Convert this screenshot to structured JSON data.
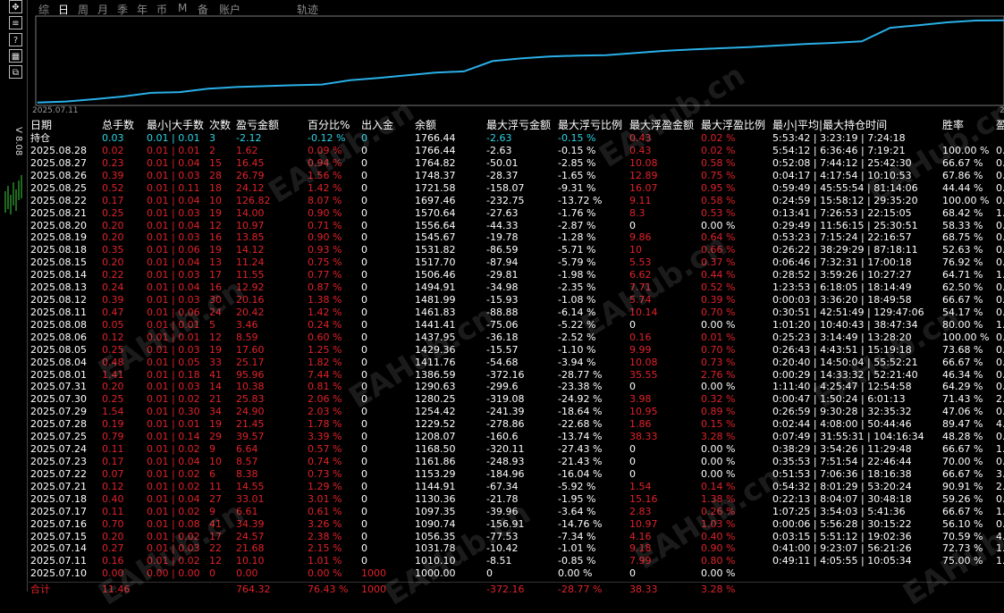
{
  "tabs": [
    "综",
    "日",
    "周",
    "月",
    "季",
    "年",
    "币",
    "M",
    "备",
    "账户",
    "轨迹"
  ],
  "active_tab": 1,
  "left_panel": {
    "version": "V 8.08"
  },
  "chart": {
    "date_start": "2025.07.11",
    "date_end": "2"
  },
  "chart_data": {
    "type": "line",
    "x": [
      "2025.07.10",
      "2025.07.11",
      "2025.07.14",
      "2025.07.15",
      "2025.07.16",
      "2025.07.17",
      "2025.07.18",
      "2025.07.21",
      "2025.07.22",
      "2025.07.23",
      "2025.07.24",
      "2025.07.25",
      "2025.07.28",
      "2025.07.29",
      "2025.07.30",
      "2025.07.31",
      "2025.08.01",
      "2025.08.04",
      "2025.08.05",
      "2025.08.06",
      "2025.08.08",
      "2025.08.11",
      "2025.08.12",
      "2025.08.13",
      "2025.08.14",
      "2025.08.15",
      "2025.08.18",
      "2025.08.19",
      "2025.08.20",
      "2025.08.21",
      "2025.08.22",
      "2025.08.25",
      "2025.08.26",
      "2025.08.27",
      "2025.08.28"
    ],
    "y": [
      1000.0,
      1010.1,
      1031.78,
      1056.35,
      1090.74,
      1097.35,
      1130.36,
      1144.91,
      1153.29,
      1161.86,
      1168.5,
      1208.07,
      1229.52,
      1254.42,
      1280.25,
      1290.63,
      1386.59,
      1411.76,
      1429.36,
      1437.95,
      1441.41,
      1461.83,
      1481.99,
      1494.91,
      1506.46,
      1517.7,
      1531.82,
      1545.67,
      1556.64,
      1570.64,
      1697.46,
      1721.58,
      1748.37,
      1764.82,
      1766.44
    ],
    "ylim": [
      990,
      1790
    ]
  },
  "table": {
    "headers": [
      "日期",
      "总手数",
      "最小|大手数",
      "次数",
      "盈亏金额",
      "百分比%",
      "出入金",
      "余额",
      "最大浮亏金额",
      "最大浮亏比例",
      "最大浮盈金额",
      "最大浮盈比例",
      "最小|平均|最大持仓时间",
      "胜率",
      "盈"
    ],
    "holding": [
      "持仓",
      "0.03",
      "0.01 | 0.01",
      "3",
      "-2.12",
      "-0.12 %",
      "0",
      "1766.44",
      "-2.63",
      "-0.15 %",
      "0.43",
      "0.02 %",
      "5:53:42 | 3:23:19 | 7:24:18",
      "",
      ""
    ],
    "rows": [
      [
        "2025.08.28",
        "0.02",
        "0.01 | 0.01",
        "2",
        "1.62",
        "0.09 %",
        "0",
        "1766.44",
        "-2.63",
        "-0.15 %",
        "0.43",
        "0.02 %",
        "5:54:12 | 6:36:46 | 7:19:21",
        "100.00 %",
        "0."
      ],
      [
        "2025.08.27",
        "0.23",
        "0.01 | 0.04",
        "15",
        "16.45",
        "0.94 %",
        "0",
        "1764.82",
        "-50.01",
        "-2.85 %",
        "10.08",
        "0.58 %",
        "0:52:08 | 7:44:12 | 25:42:30",
        "66.67 %",
        "0."
      ],
      [
        "2025.08.26",
        "0.39",
        "0.01 | 0.03",
        "28",
        "26.79",
        "1.56 %",
        "0",
        "1748.37",
        "-28.37",
        "-1.65 %",
        "12.89",
        "0.75 %",
        "0:04:17 | 4:17:54 | 10:10:53",
        "67.86 %",
        "0."
      ],
      [
        "2025.08.25",
        "0.52",
        "0.01 | 0.11",
        "18",
        "24.12",
        "1.42 %",
        "0",
        "1721.58",
        "-158.07",
        "-9.31 %",
        "16.07",
        "0.95 %",
        "0:59:49 | 45:55:54 | 81:14:06",
        "44.44 %",
        "0."
      ],
      [
        "2025.08.22",
        "0.17",
        "0.01 | 0.04",
        "10",
        "126.82",
        "8.07 %",
        "0",
        "1697.46",
        "-232.75",
        "-13.72 %",
        "9.11",
        "0.58 %",
        "0:24:59 | 15:58:12 | 29:35:20",
        "100.00 %",
        "0."
      ],
      [
        "2025.08.21",
        "0.25",
        "0.01 | 0.03",
        "19",
        "14.00",
        "0.90 %",
        "0",
        "1570.64",
        "-27.63",
        "-1.76 %",
        "8.3",
        "0.53 %",
        "0:13:41 | 7:26:53 | 22:15:05",
        "68.42 %",
        "1."
      ],
      [
        "2025.08.20",
        "0.20",
        "0.01 | 0.04",
        "12",
        "10.97",
        "0.71 %",
        "0",
        "1556.64",
        "-44.33",
        "-2.87 %",
        "0",
        "0.00 %",
        "0:29:49 | 11:56:15 | 25:30:51",
        "58.33 %",
        "0."
      ],
      [
        "2025.08.19",
        "0.20",
        "0.01 | 0.03",
        "16",
        "13.85",
        "0.90 %",
        "0",
        "1545.67",
        "-19.78",
        "-1.28 %",
        "9.86",
        "0.64 %",
        "0:53:23 | 7:15:24 | 22:16:57",
        "68.75 %",
        "0."
      ],
      [
        "2025.08.18",
        "0.35",
        "0.01 | 0.06",
        "19",
        "14.12",
        "0.93 %",
        "0",
        "1531.82",
        "-86.59",
        "-5.71 %",
        "10",
        "0.66 %",
        "0:26:22 | 38:29:29 | 87:18:11",
        "52.63 %",
        "0."
      ],
      [
        "2025.08.15",
        "0.20",
        "0.01 | 0.04",
        "13",
        "11.24",
        "0.75 %",
        "0",
        "1517.70",
        "-87.94",
        "-5.79 %",
        "5.53",
        "0.37 %",
        "0:06:46 | 7:32:31 | 17:00:18",
        "76.92 %",
        "0."
      ],
      [
        "2025.08.14",
        "0.22",
        "0.01 | 0.03",
        "17",
        "11.55",
        "0.77 %",
        "0",
        "1506.46",
        "-29.81",
        "-1.98 %",
        "6.62",
        "0.44 %",
        "0:28:52 | 3:59:26 | 10:27:27",
        "64.71 %",
        "1."
      ],
      [
        "2025.08.13",
        "0.24",
        "0.01 | 0.04",
        "16",
        "12.92",
        "0.87 %",
        "0",
        "1494.91",
        "-34.98",
        "-2.35 %",
        "7.71",
        "0.52 %",
        "1:23:53 | 6:18:05 | 18:14:49",
        "62.50 %",
        "0."
      ],
      [
        "2025.08.12",
        "0.39",
        "0.01 | 0.03",
        "30",
        "20.16",
        "1.38 %",
        "0",
        "1481.99",
        "-15.93",
        "-1.08 %",
        "5.74",
        "0.39 %",
        "0:00:03 | 3:36:20 | 18:49:58",
        "66.67 %",
        "0."
      ],
      [
        "2025.08.11",
        "0.47",
        "0.01 | 0.06",
        "24",
        "20.42",
        "1.42 %",
        "0",
        "1461.83",
        "-88.88",
        "-6.14 %",
        "10.14",
        "0.70 %",
        "0:30:51 | 42:51:49 | 129:47:06",
        "54.17 %",
        "0."
      ],
      [
        "2025.08.08",
        "0.05",
        "0.01 | 0.01",
        "5",
        "3.46",
        "0.24 %",
        "0",
        "1441.41",
        "-75.06",
        "-5.22 %",
        "0",
        "0.00 %",
        "1:01:20 | 10:40:43 | 38:47:34",
        "80.00 %",
        "1."
      ],
      [
        "2025.08.06",
        "0.12",
        "0.01 | 0.01",
        "12",
        "8.59",
        "0.60 %",
        "0",
        "1437.95",
        "-36.18",
        "-2.52 %",
        "0.16",
        "0.01 %",
        "0:25:23 | 3:14:49 | 13:28:20",
        "100.00 %",
        "0."
      ],
      [
        "2025.08.05",
        "0.25",
        "0.01 | 0.03",
        "19",
        "17.60",
        "1.25 %",
        "0",
        "1429.36",
        "-15.57",
        "-1.10 %",
        "9.99",
        "0.70 %",
        "0:26:43 | 4:43:51 | 15:19:18",
        "73.68 %",
        "0."
      ],
      [
        "2025.08.04",
        "0.48",
        "0.01 | 0.05",
        "33",
        "25.17",
        "1.82 %",
        "0",
        "1411.76",
        "-54.68",
        "-3.94 %",
        "10.08",
        "0.73 %",
        "0:20:40 | 14:50:04 | 55:52:21",
        "66.67 %",
        "0."
      ],
      [
        "2025.08.01",
        "1.41",
        "0.01 | 0.18",
        "41",
        "95.96",
        "7.44 %",
        "0",
        "1386.59",
        "-372.16",
        "-28.77 %",
        "35.55",
        "2.76 %",
        "0:00:29 | 14:33:32 | 52:21:40",
        "46.34 %",
        "0."
      ],
      [
        "2025.07.31",
        "0.20",
        "0.01 | 0.03",
        "14",
        "10.38",
        "0.81 %",
        "0",
        "1290.63",
        "-299.6",
        "-23.38 %",
        "0",
        "0.00 %",
        "1:11:40 | 4:25:47 | 12:54:58",
        "64.29 %",
        "0."
      ],
      [
        "2025.07.30",
        "0.25",
        "0.01 | 0.02",
        "21",
        "25.83",
        "2.06 %",
        "0",
        "1280.25",
        "-319.08",
        "-24.92 %",
        "3.98",
        "0.32 %",
        "0:00:47 | 1:50:24 | 6:01:13",
        "71.43 %",
        "2."
      ],
      [
        "2025.07.29",
        "1.54",
        "0.01 | 0.30",
        "34",
        "24.90",
        "2.03 %",
        "0",
        "1254.42",
        "-241.39",
        "-18.64 %",
        "10.95",
        "0.89 %",
        "0:26:59 | 9:30:28 | 32:35:32",
        "47.06 %",
        "0."
      ],
      [
        "2025.07.28",
        "0.19",
        "0.01 | 0.01",
        "19",
        "21.45",
        "1.78 %",
        "0",
        "1229.52",
        "-278.86",
        "-22.68 %",
        "1.86",
        "0.15 %",
        "0:02:44 | 4:08:00 | 50:44:46",
        "89.47 %",
        "4."
      ],
      [
        "2025.07.25",
        "0.79",
        "0.01 | 0.14",
        "29",
        "39.57",
        "3.39 %",
        "0",
        "1208.07",
        "-160.6",
        "-13.74 %",
        "38.33",
        "3.28 %",
        "0:07:49 | 31:55:31 | 104:16:34",
        "48.28 %",
        "0."
      ],
      [
        "2025.07.24",
        "0.11",
        "0.01 | 0.02",
        "9",
        "6.64",
        "0.57 %",
        "0",
        "1168.50",
        "-320.11",
        "-27.43 %",
        "0",
        "0.00 %",
        "0:38:29 | 3:54:26 | 11:29:48",
        "66.67 %",
        "1."
      ],
      [
        "2025.07.23",
        "0.17",
        "0.01 | 0.04",
        "10",
        "8.57",
        "0.74 %",
        "0",
        "1161.86",
        "-248.93",
        "-21.43 %",
        "0",
        "0.00 %",
        "0:35:53 | 7:51:54 | 22:46:44",
        "70.00 %",
        "0."
      ],
      [
        "2025.07.22",
        "0.07",
        "0.01 | 0.02",
        "6",
        "8.38",
        "0.73 %",
        "0",
        "1153.29",
        "-184.96",
        "-16.04 %",
        "0",
        "0.00 %",
        "0:51:53 | 7:06:36 | 18:16:38",
        "66.67 %",
        "3."
      ],
      [
        "2025.07.21",
        "0.12",
        "0.01 | 0.02",
        "11",
        "14.55",
        "1.29 %",
        "0",
        "1144.91",
        "-67.34",
        "-5.92 %",
        "1.54",
        "0.14 %",
        "0:54:32 | 8:01:29 | 53:20:24",
        "90.91 %",
        "2."
      ],
      [
        "2025.07.18",
        "0.40",
        "0.01 | 0.04",
        "27",
        "33.01",
        "3.01 %",
        "0",
        "1130.36",
        "-21.78",
        "-1.95 %",
        "15.16",
        "1.38 %",
        "0:22:13 | 8:04:07 | 30:48:18",
        "59.26 %",
        "0."
      ],
      [
        "2025.07.17",
        "0.11",
        "0.01 | 0.02",
        "9",
        "6.61",
        "0.61 %",
        "0",
        "1097.35",
        "-39.96",
        "-3.64 %",
        "2.83",
        "0.26 %",
        "1:07:25 | 3:54:03 | 5:41:36",
        "66.67 %",
        "1."
      ],
      [
        "2025.07.16",
        "0.70",
        "0.01 | 0.08",
        "41",
        "34.39",
        "3.26 %",
        "0",
        "1090.74",
        "-156.91",
        "-14.76 %",
        "10.97",
        "1.03 %",
        "0:00:06 | 5:56:28 | 30:15:22",
        "56.10 %",
        "0."
      ],
      [
        "2025.07.15",
        "0.20",
        "0.01 | 0.02",
        "17",
        "24.57",
        "2.38 %",
        "0",
        "1056.35",
        "-77.53",
        "-7.34 %",
        "4.16",
        "0.40 %",
        "0:03:15 | 5:51:12 | 19:02:36",
        "70.59 %",
        "4."
      ],
      [
        "2025.07.14",
        "0.27",
        "0.01 | 0.03",
        "22",
        "21.68",
        "2.15 %",
        "0",
        "1031.78",
        "-10.42",
        "-1.01 %",
        "9.18",
        "0.90 %",
        "0:41:00 | 9:23:07 | 56:21:26",
        "72.73 %",
        "1."
      ],
      [
        "2025.07.11",
        "0.16",
        "0.01 | 0.02",
        "12",
        "10.10",
        "1.01 %",
        "0",
        "1010.10",
        "-8.51",
        "-0.85 %",
        "7.99",
        "0.80 %",
        "0:49:11 | 4:05:55 | 10:05:34",
        "75.00 %",
        "1."
      ],
      [
        "2025.07.10",
        "0.00",
        "0.00 | 0.00",
        "0",
        "0.00",
        "0.00 %",
        "1000",
        "1000.00",
        "0",
        "0.00 %",
        "0",
        "0.00 %",
        "",
        "",
        ""
      ]
    ],
    "total": [
      "合计",
      "11.46",
      "",
      "",
      "764.32",
      "76.43 %",
      "1000",
      "",
      "-372.16",
      "-28.77 %",
      "38.33",
      "3.28 %",
      "",
      "",
      ""
    ]
  },
  "watermark": "EAHub.cn",
  "colors": {
    "positive": "#e0222a",
    "neutral": "#ffffff",
    "holding": "#2ad6e6",
    "line": "#2ab0e8"
  }
}
